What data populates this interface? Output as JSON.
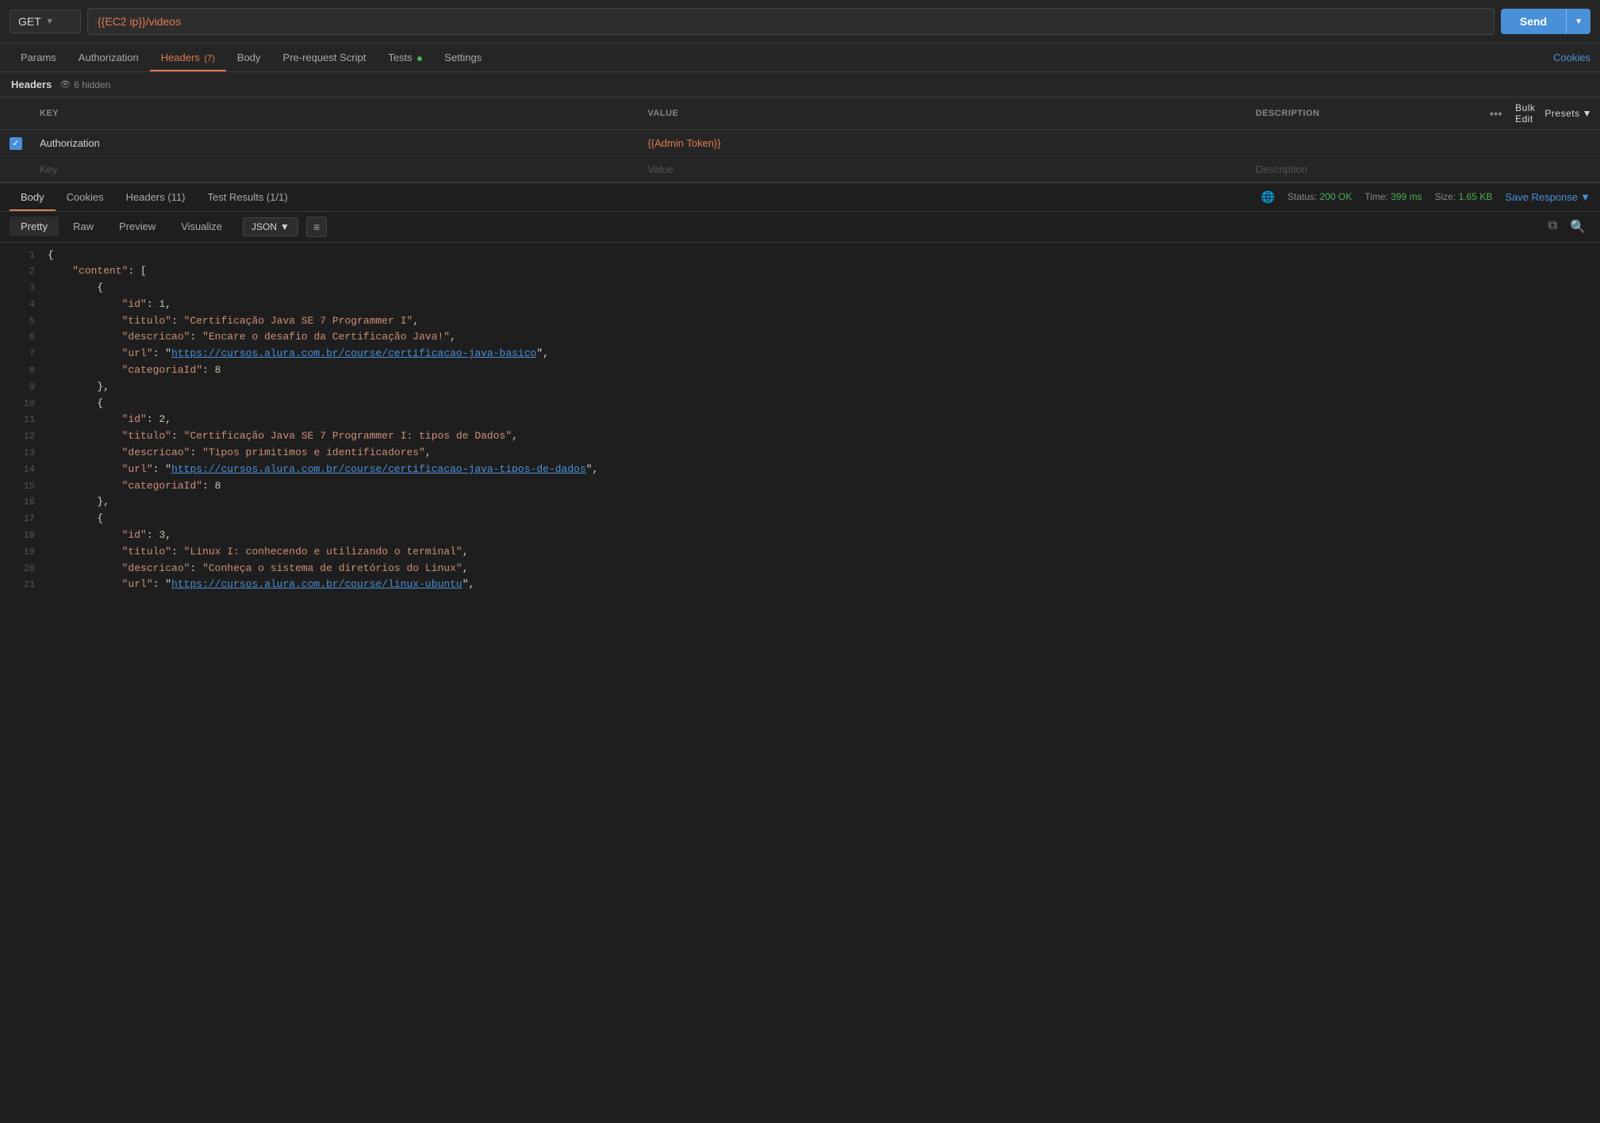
{
  "request": {
    "method": "GET",
    "url": "{{EC2 ip}}/videos",
    "send_label": "Send"
  },
  "tabs": {
    "items": [
      {
        "label": "Params",
        "active": false
      },
      {
        "label": "Authorization",
        "active": false
      },
      {
        "label": "Headers",
        "active": true,
        "badge": "(7)"
      },
      {
        "label": "Body",
        "active": false
      },
      {
        "label": "Pre-request Script",
        "active": false
      },
      {
        "label": "Tests",
        "active": false,
        "dot": true
      },
      {
        "label": "Settings",
        "active": false
      }
    ],
    "cookies_label": "Cookies"
  },
  "headers_section": {
    "title": "Headers",
    "hidden_count": "6 hidden",
    "bulk_edit_label": "Bulk Edit",
    "presets_label": "Presets",
    "columns": {
      "key": "KEY",
      "value": "VALUE",
      "description": "DESCRIPTION"
    },
    "rows": [
      {
        "checked": true,
        "key": "Authorization",
        "value": "{{Admin Token}}",
        "description": ""
      }
    ],
    "empty_row": {
      "key_placeholder": "Key",
      "value_placeholder": "Value",
      "desc_placeholder": "Description"
    }
  },
  "response": {
    "tabs": [
      "Body",
      "Cookies",
      "Headers (11)",
      "Test Results (1/1)"
    ],
    "active_tab": "Body",
    "status_label": "Status:",
    "status_code": "200 OK",
    "time_label": "Time:",
    "time_value": "399 ms",
    "size_label": "Size:",
    "size_value": "1.65 KB",
    "save_response_label": "Save Response",
    "format_tabs": [
      "Pretty",
      "Raw",
      "Preview",
      "Visualize"
    ],
    "active_format": "Pretty",
    "format_type": "JSON",
    "json_lines": [
      {
        "num": 1,
        "content": "{"
      },
      {
        "num": 2,
        "content": "    \"content\": ["
      },
      {
        "num": 3,
        "content": "        {"
      },
      {
        "num": 4,
        "content": "            \"id\": 1,"
      },
      {
        "num": 5,
        "content": "            \"titulo\": \"Certificação Java SE 7 Programmer I\","
      },
      {
        "num": 6,
        "content": "            \"descricao\": \"Encare o desafio da Certificação Java!\","
      },
      {
        "num": 7,
        "content": "            \"url\": \"https://cursos.alura.com.br/course/certificacao-java-basico\","
      },
      {
        "num": 8,
        "content": "            \"categoriaId\": 8"
      },
      {
        "num": 9,
        "content": "        },"
      },
      {
        "num": 10,
        "content": "        {"
      },
      {
        "num": 11,
        "content": "            \"id\": 2,"
      },
      {
        "num": 12,
        "content": "            \"titulo\": \"Certificação Java SE 7 Programmer I: tipos de Dados\","
      },
      {
        "num": 13,
        "content": "            \"descricao\": \"Tipos primitimos e identificadores\","
      },
      {
        "num": 14,
        "content": "            \"url\": \"https://cursos.alura.com.br/course/certificacao-java-tipos-de-dados\","
      },
      {
        "num": 15,
        "content": "            \"categoriaId\": 8"
      },
      {
        "num": 16,
        "content": "        },"
      },
      {
        "num": 17,
        "content": "        {"
      },
      {
        "num": 18,
        "content": "            \"id\": 3,"
      },
      {
        "num": 19,
        "content": "            \"titulo\": \"Linux I: conhecendo e utilizando o terminal\","
      },
      {
        "num": 20,
        "content": "            \"descricao\": \"Conheça o sistema de diretórios do Linux\","
      },
      {
        "num": 21,
        "content": "            \"url\": \"https://cursos.alura.com.br/course/linux-ubuntu\","
      }
    ]
  }
}
